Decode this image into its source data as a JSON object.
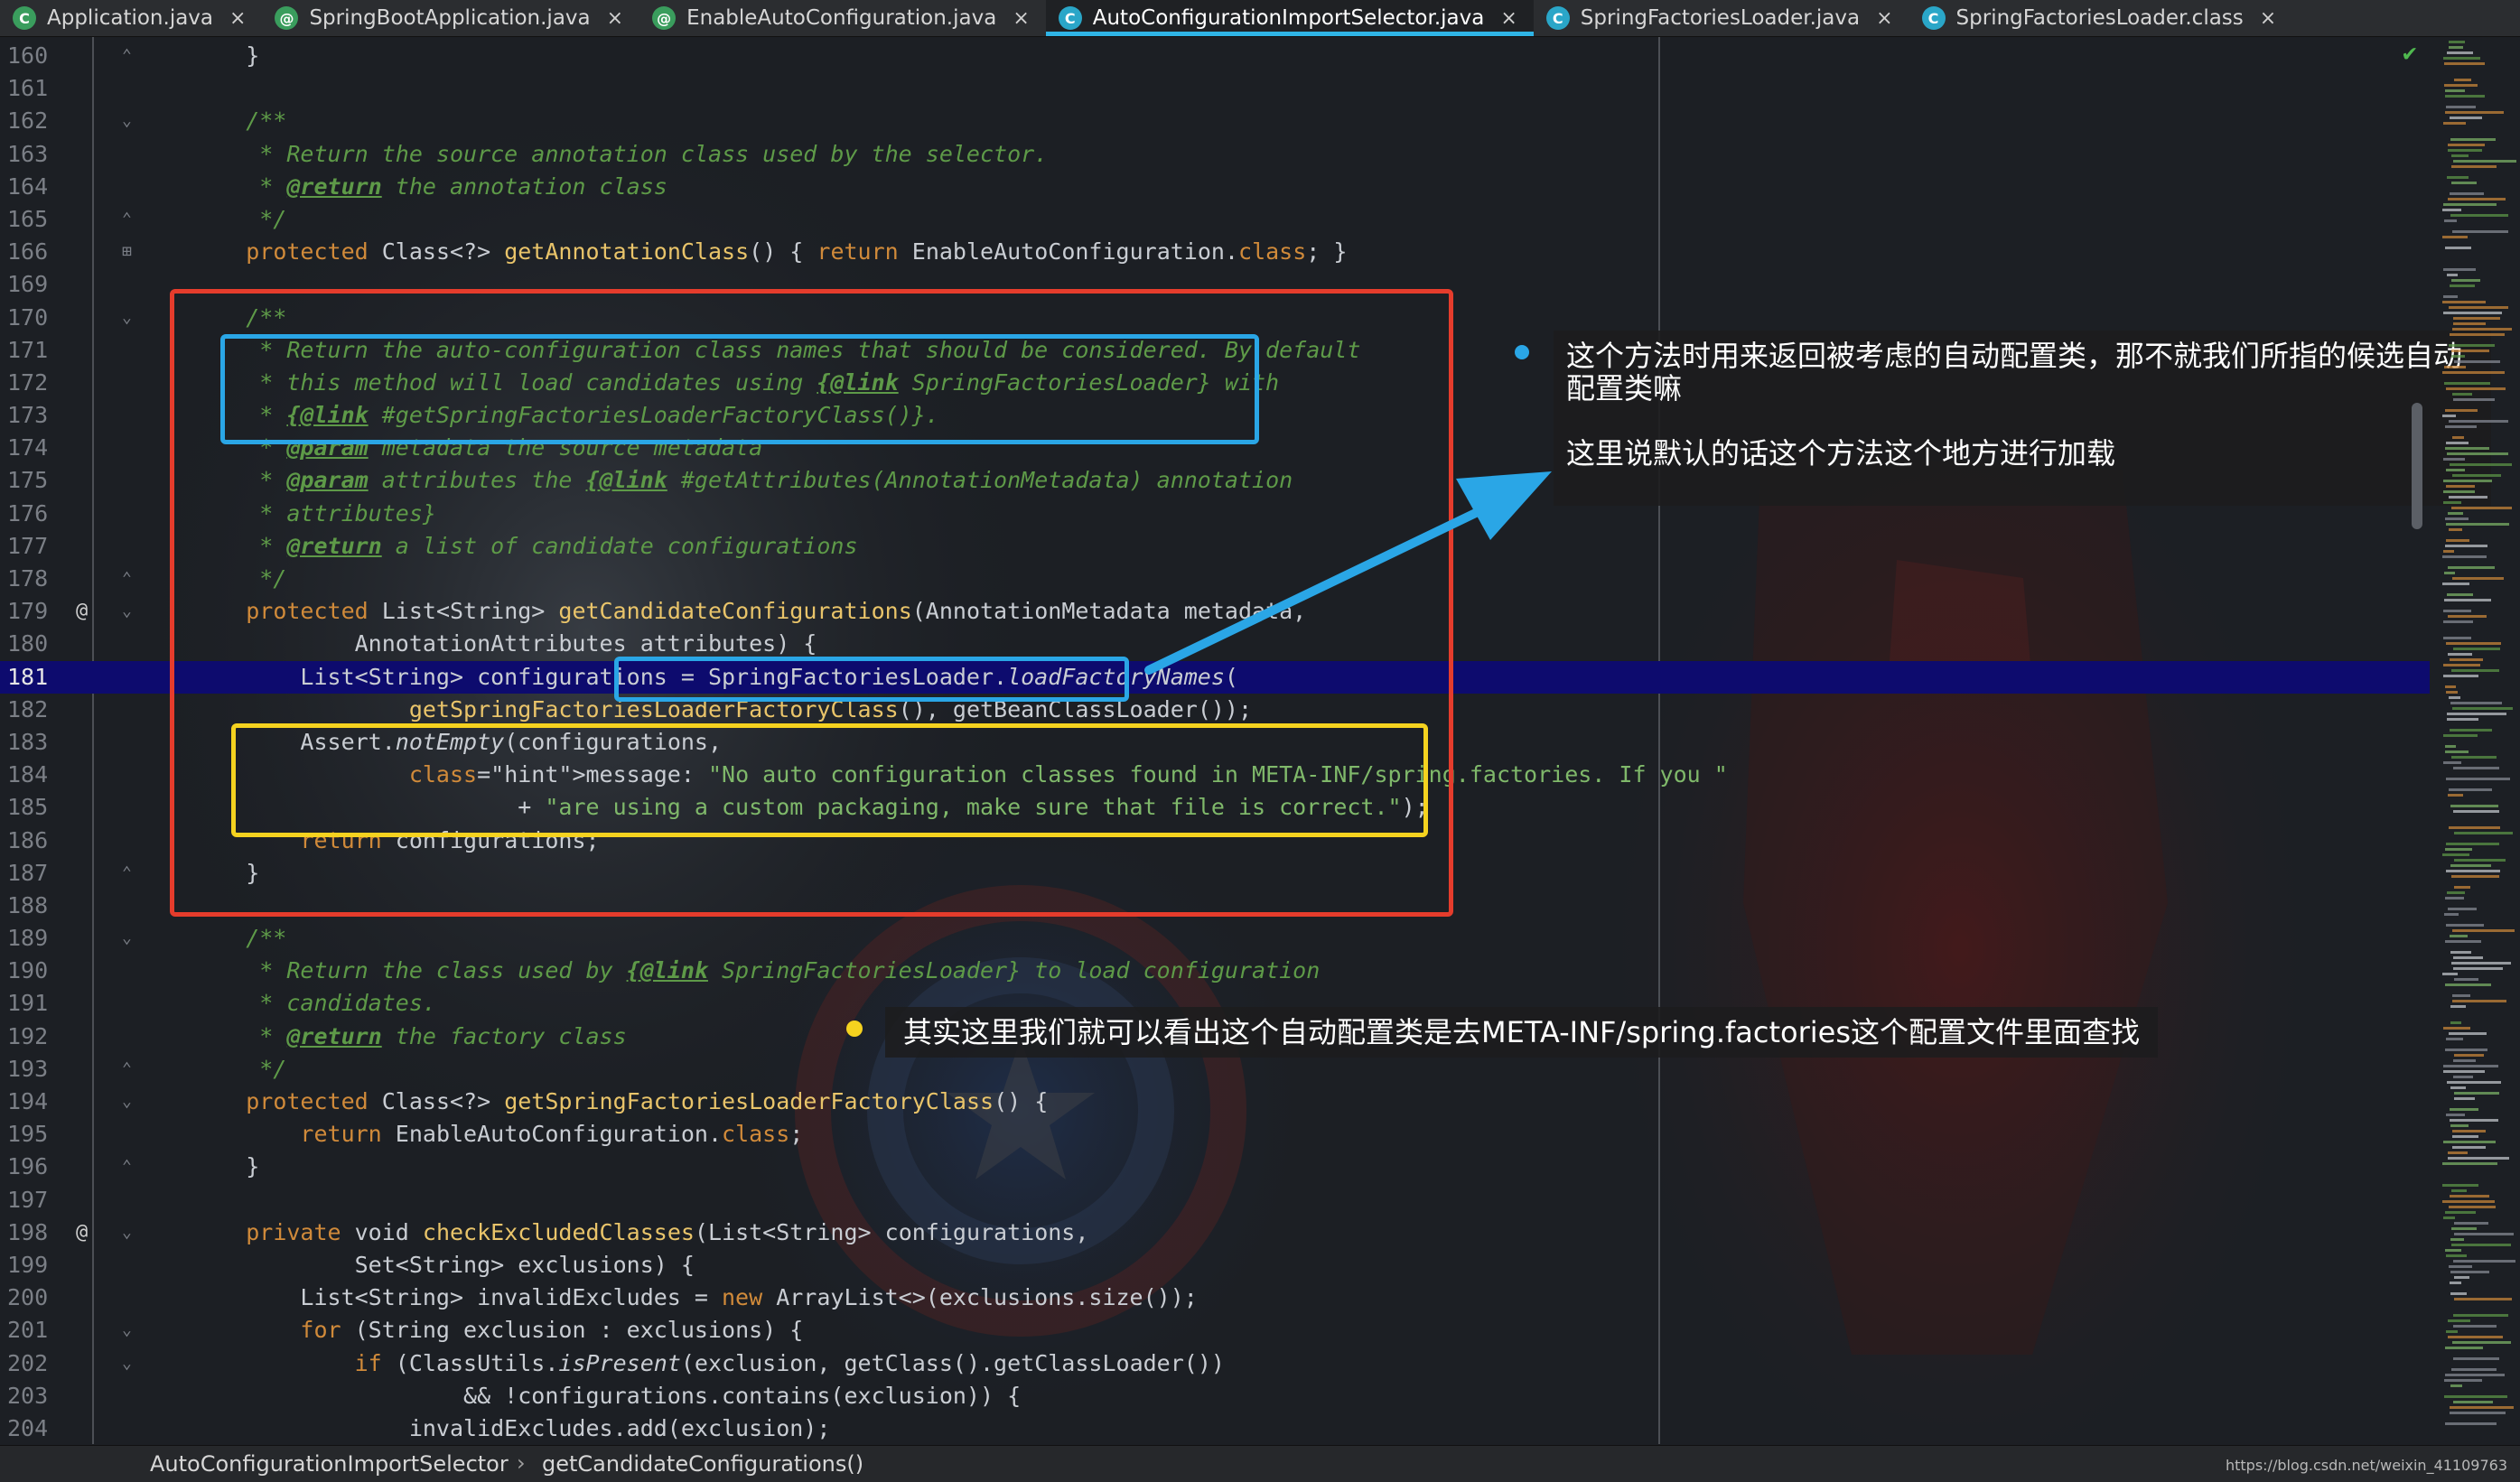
{
  "tabs": [
    {
      "label": "Application.java",
      "icon": "spring-boot-class-icon",
      "active": false
    },
    {
      "label": "SpringBootApplication.java",
      "icon": "annotation-icon",
      "active": false
    },
    {
      "label": "EnableAutoConfiguration.java",
      "icon": "annotation-icon",
      "active": false
    },
    {
      "label": "AutoConfigurationImportSelector.java",
      "icon": "class-icon",
      "active": true
    },
    {
      "label": "SpringFactoriesLoader.java",
      "icon": "class-icon",
      "active": false
    },
    {
      "label": "SpringFactoriesLoader.class",
      "icon": "class-icon",
      "active": false
    }
  ],
  "tab_close_glyph": "×",
  "current_line": "181",
  "lines": [
    {
      "n": "160",
      "fold": "end",
      "code": "    }"
    },
    {
      "n": "161",
      "code": ""
    },
    {
      "n": "162",
      "fold": "start",
      "code": "    /**"
    },
    {
      "n": "163",
      "code": "     * Return the source annotation class used by the selector."
    },
    {
      "n": "164",
      "code": "     * @return the annotation class"
    },
    {
      "n": "165",
      "fold": "end",
      "code": "     */"
    },
    {
      "n": "166",
      "fold": "plus",
      "code": "    protected Class<?> getAnnotationClass() { return EnableAutoConfiguration.class; }"
    },
    {
      "n": "169",
      "code": ""
    },
    {
      "n": "170",
      "fold": "start",
      "code": "    /**"
    },
    {
      "n": "171",
      "code": "     * Return the auto-configuration class names that should be considered. By default"
    },
    {
      "n": "172",
      "code": "     * this method will load candidates using {@link SpringFactoriesLoader} with"
    },
    {
      "n": "173",
      "code": "     * {@link #getSpringFactoriesLoaderFactoryClass()}."
    },
    {
      "n": "174",
      "code": "     * @param metadata the source metadata"
    },
    {
      "n": "175",
      "code": "     * @param attributes the {@link #getAttributes(AnnotationMetadata) annotation"
    },
    {
      "n": "176",
      "code": "     * attributes}"
    },
    {
      "n": "177",
      "code": "     * @return a list of candidate configurations"
    },
    {
      "n": "178",
      "fold": "end",
      "code": "     */"
    },
    {
      "n": "179",
      "fold": "start",
      "code": "    protected List<String> getCandidateConfigurations(AnnotationMetadata metadata,"
    },
    {
      "n": "180",
      "code": "            AnnotationAttributes attributes) {"
    },
    {
      "n": "181",
      "code": "        List<String> configurations = SpringFactoriesLoader.loadFactoryNames("
    },
    {
      "n": "182",
      "code": "                getSpringFactoriesLoaderFactoryClass(), getBeanClassLoader());"
    },
    {
      "n": "183",
      "code": "        Assert.notEmpty(configurations,"
    },
    {
      "n": "184",
      "code": "                message: \"No auto configuration classes found in META-INF/spring.factories. If you \""
    },
    {
      "n": "185",
      "code": "                        + \"are using a custom packaging, make sure that file is correct.\");"
    },
    {
      "n": "186",
      "code": "        return configurations;"
    },
    {
      "n": "187",
      "fold": "end",
      "code": "    }"
    },
    {
      "n": "188",
      "code": ""
    },
    {
      "n": "189",
      "fold": "start",
      "code": "    /**"
    },
    {
      "n": "190",
      "code": "     * Return the class used by {@link SpringFactoriesLoader} to load configuration"
    },
    {
      "n": "191",
      "code": "     * candidates."
    },
    {
      "n": "192",
      "code": "     * @return the factory class"
    },
    {
      "n": "193",
      "fold": "end",
      "code": "     */"
    },
    {
      "n": "194",
      "fold": "start",
      "code": "    protected Class<?> getSpringFactoriesLoaderFactoryClass() {"
    },
    {
      "n": "195",
      "code": "        return EnableAutoConfiguration.class;"
    },
    {
      "n": "196",
      "fold": "end",
      "code": "    }"
    },
    {
      "n": "197",
      "code": ""
    },
    {
      "n": "198",
      "fold": "start",
      "code": "    private void checkExcludedClasses(List<String> configurations,"
    },
    {
      "n": "199",
      "code": "            Set<String> exclusions) {"
    },
    {
      "n": "200",
      "code": "        List<String> invalidExcludes = new ArrayList<>(exclusions.size());"
    },
    {
      "n": "201",
      "fold": "start",
      "code": "        for (String exclusion : exclusions) {"
    },
    {
      "n": "202",
      "fold": "start",
      "code": "            if (ClassUtils.isPresent(exclusion, getClass().getClassLoader())"
    },
    {
      "n": "203",
      "code": "                    && !configurations.contains(exclusion)) {"
    },
    {
      "n": "204",
      "code": "                invalidExcludes.add(exclusion);"
    }
  ],
  "gutter_icons": {
    "179": "@",
    "198": "@"
  },
  "inlay_hint": "message:",
  "notes": {
    "note1_line1": "这个方法时用来返回被考虑的自动配置类，那不就我们所指的候选自动配置类嘛",
    "note1_line2": "这里说默认的话这个方法这个地方进行加载",
    "note2": "其实这里我们就可以看出这个自动配置类是去META-INF/spring.factories这个配置文件里面查找"
  },
  "status": {
    "crumb_class": "AutoConfigurationImportSelector",
    "crumb_sep": "›",
    "crumb_method": "getCandidateConfigurations()",
    "watermark": "https://blog.csdn.net/weixin_41109763"
  },
  "colors": {
    "accent_tab": "#2fb4e6",
    "annotation_red": "#e53c2c",
    "annotation_blue": "#2aa6e6",
    "annotation_yellow": "#f5d21f",
    "current_line_bg": "#0d0b6e"
  }
}
